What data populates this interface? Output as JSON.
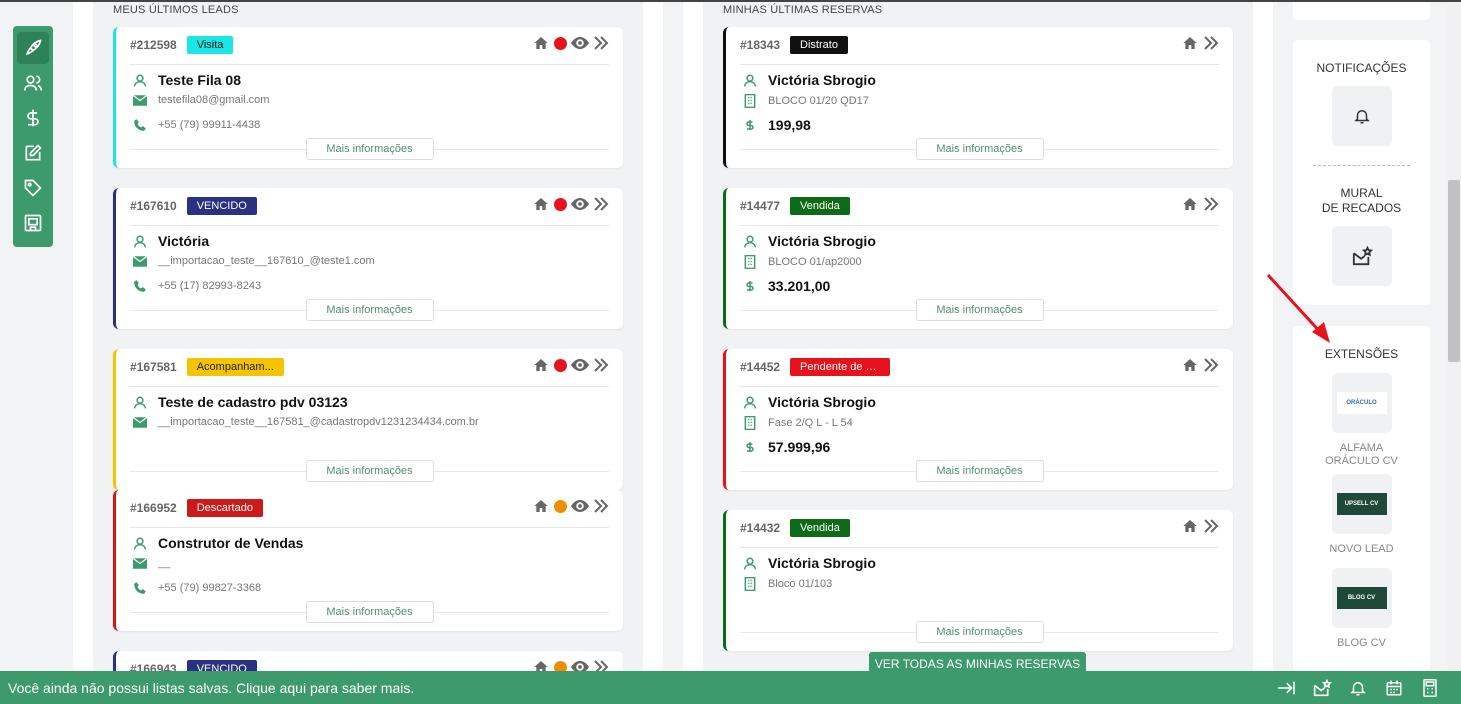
{
  "colors": {
    "accent": "#3d9a6c",
    "tag_visita": "#1ae6e6",
    "tag_vencido": "#2a3180",
    "tag_acompanhamento": "#f5c400",
    "tag_descartado": "#cc1a1a",
    "tag_distrato": "#111111",
    "tag_vendida": "#0d6b17",
    "tag_pendente": "#e8121c"
  },
  "leads": {
    "title": "MEUS ÚLTIMOS LEADS",
    "more_label": "Mais informações",
    "items": [
      {
        "id": "#212598",
        "status": "Visita",
        "name": "Teste Fila 08",
        "email": "testefila08@gmail.com",
        "phone": "+55 (79) 99911-4438",
        "dot": "#e8121c"
      },
      {
        "id": "#167610",
        "status": "VENCIDO",
        "name": "Victória",
        "email": "__importacao_teste__167610_@teste1.com",
        "phone": "+55 (17) 82993-8243",
        "dot": "#e8121c"
      },
      {
        "id": "#167581",
        "status": "Acompanham...",
        "name": "Teste de cadastro pdv 03123",
        "email": "__importacao_teste__167581_@cadastropdv1231234434.com.br",
        "phone": "",
        "dot": "#e8121c"
      },
      {
        "id": "#166952",
        "status": "Descartado",
        "name": "Construtor de Vendas",
        "email": "__",
        "phone": "+55 (79) 99827-3368",
        "dot": "#f08c00"
      },
      {
        "id": "#166943",
        "status": "VENCIDO",
        "dot": "#f08c00"
      }
    ]
  },
  "reservations": {
    "title": "MINHAS ÚLTIMAS RESERVAS",
    "more_label": "Mais informações",
    "see_all_label": "VER TODAS AS MINHAS RESERVAS",
    "items": [
      {
        "id": "#18343",
        "status": "Distrato",
        "name": "Victória Sbrogio",
        "unit": "BLOCO 01/20 QD17",
        "value": "199,98"
      },
      {
        "id": "#14477",
        "status": "Vendida",
        "name": "Victória Sbrogio",
        "unit": "BLOCO 01/ap2000",
        "value": "33.201,00"
      },
      {
        "id": "#14452",
        "status": "Pendente de a...",
        "name": "Victória Sbrogio",
        "unit": "Fase 2/Q L - L 54",
        "value": "57.999,96"
      },
      {
        "id": "#14432",
        "status": "Vendida",
        "name": "Victória Sbrogio",
        "unit": "Bloco 01/103",
        "value": ""
      }
    ]
  },
  "right_panel": {
    "notifications_title": "NOTIFICAÇÕES",
    "mural_title_line1": "MURAL",
    "mural_title_line2": "DE RECADOS",
    "extensions_title": "EXTENSÕES",
    "extensions": [
      {
        "label_line1": "ALFAMA",
        "label_line2": "ORÁCULO CV",
        "logo_text": "ORÁCULO"
      },
      {
        "label_line1": "NOVO LEAD",
        "label_line2": "",
        "logo_text": "UPSELL CV"
      },
      {
        "label_line1": "BLOG CV",
        "label_line2": "",
        "logo_text": "BLOG CV"
      }
    ]
  },
  "bottom_bar": {
    "message": "Você ainda não possui listas salvas. Clique aqui para saber mais."
  },
  "sidebar": {
    "items": [
      "rocket-icon",
      "users-icon",
      "dollar-icon",
      "edit-icon",
      "tag-icon",
      "building-icon"
    ]
  }
}
